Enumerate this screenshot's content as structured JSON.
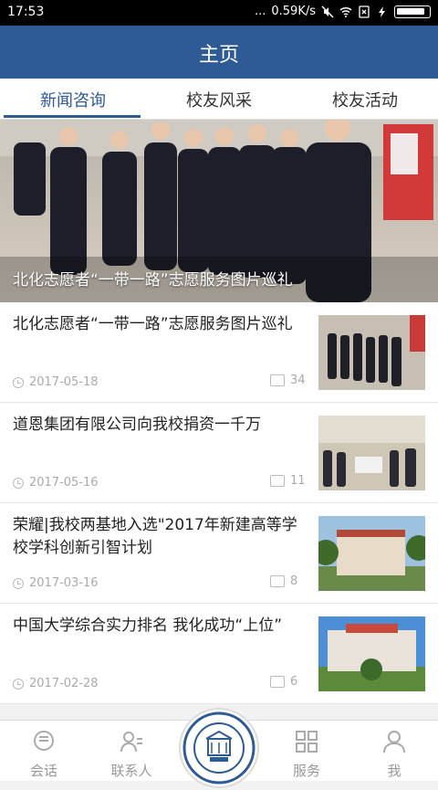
{
  "status_bar": {
    "time": "17:53",
    "dots": "...",
    "speed": "0.59K/s",
    "battery_level": 0.9
  },
  "header": {
    "title": "主页"
  },
  "tabs": [
    {
      "label": "新闻咨询",
      "active": true
    },
    {
      "label": "校友风采",
      "active": false
    },
    {
      "label": "校友活动",
      "active": false
    }
  ],
  "hero": {
    "caption": "北化志愿者“一带一路”志愿服务图片巡礼"
  },
  "news": [
    {
      "title": "北化志愿者“一带一路”志愿服务图片巡礼",
      "date": "2017-05-18",
      "comments": "34"
    },
    {
      "title": "道恩集团有限公司向我校捐资一千万",
      "date": "2017-05-16",
      "comments": "11"
    },
    {
      "title": "荣耀|我校两基地入选\"2017年新建高等学校学科创新引智计划",
      "date": "2017-03-16",
      "comments": "8"
    },
    {
      "title": "中国大学综合实力排名 我化成功“上位”",
      "date": "2017-02-28",
      "comments": "6"
    }
  ],
  "bottom_nav": [
    {
      "label": "会话",
      "icon": "chat-icon"
    },
    {
      "label": "联系人",
      "icon": "contacts-icon"
    },
    {
      "label": "服务",
      "icon": "grid-icon"
    },
    {
      "label": "我",
      "icon": "person-icon"
    }
  ],
  "colors": {
    "primary": "#2e5a96",
    "tab_active": "#2e5a96",
    "meta_text": "#aaaaaa"
  }
}
